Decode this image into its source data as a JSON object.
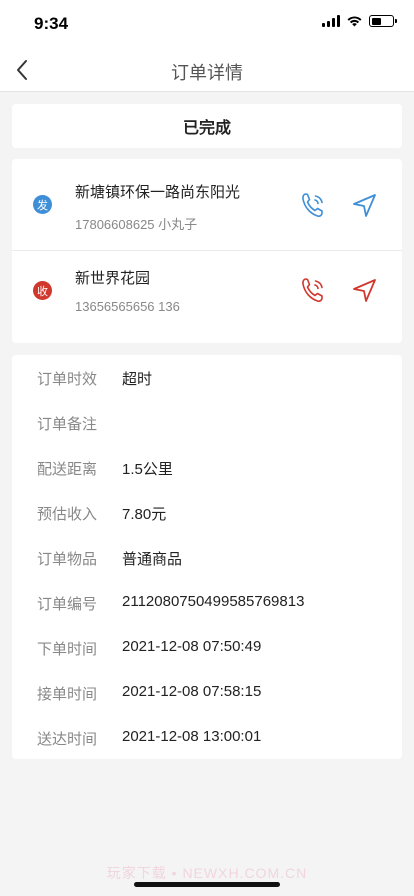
{
  "status_bar": {
    "time": "9:34"
  },
  "nav": {
    "title": "订单详情"
  },
  "order_status": "已完成",
  "sender": {
    "badge": "发",
    "address": "新塘镇环保一路尚东阳光",
    "contact": "17806608625 小丸子",
    "color": "#3e8fd8"
  },
  "receiver": {
    "badge": "收",
    "address": "新世界花园",
    "contact": "13656565656 136",
    "color": "#d0382e"
  },
  "details": [
    {
      "label": "订单时效",
      "value": "超时"
    },
    {
      "label": "订单备注",
      "value": ""
    },
    {
      "label": "配送距离",
      "value": "1.5公里"
    },
    {
      "label": "预估收入",
      "value": "7.80元"
    },
    {
      "label": "订单物品",
      "value": "普通商品"
    },
    {
      "label": "订单编号",
      "value": "211208075049958576981​3"
    },
    {
      "label": "下单时间",
      "value": "2021-12-08 07:50:49"
    },
    {
      "label": "接单时间",
      "value": "2021-12-08 07:58:15"
    },
    {
      "label": "送达时间",
      "value": "2021-12-08 13:00:01"
    }
  ],
  "watermark": "玩家下载 • NEWXH.COM.CN",
  "icons": {
    "back": "chevron-left-icon",
    "phone": "phone-icon",
    "navigate": "navigation-arrow-icon"
  }
}
